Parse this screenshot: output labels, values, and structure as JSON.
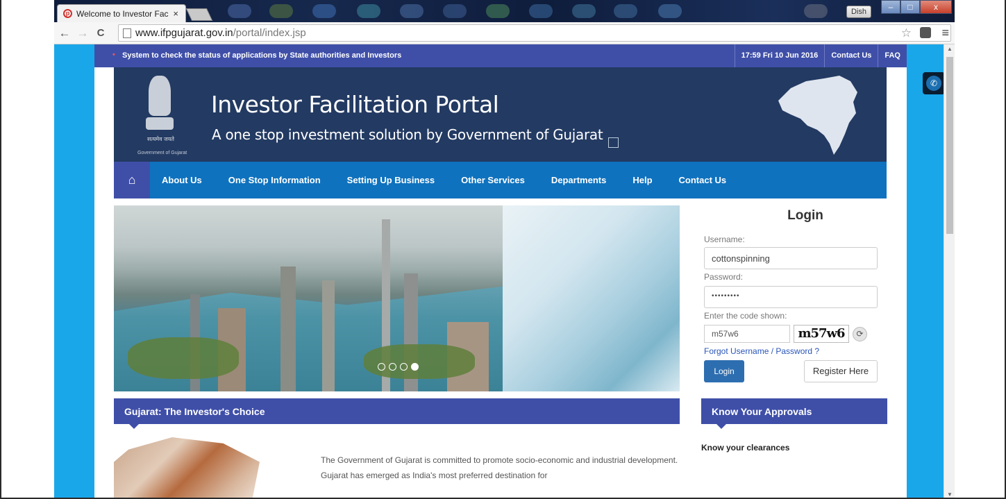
{
  "browser": {
    "tab_title": "Welcome to Investor Facil",
    "tab_close": "×",
    "url_domain": "www.ifpgujarat.gov.in",
    "url_path": "/portal/index.jsp",
    "profile_label": "Dish",
    "minimize": "–",
    "maximize": "□",
    "close": "x"
  },
  "topbar": {
    "ticker": "System to check the status of applications by State authorities and Investors",
    "time": "17:59  Fri  10 Jun 2016",
    "contact": "Contact Us",
    "faq": "FAQ"
  },
  "banner": {
    "title": "Investor Facilitation Portal",
    "subtitle": "A one stop investment solution by Government of Gujarat",
    "emblem_motto": "सत्यमेव जयते",
    "emblem_caption": "Government of Gujarat"
  },
  "nav": {
    "items": [
      "About Us",
      "One Stop Information",
      "Setting Up Business",
      "Other Services",
      "Departments",
      "Help",
      "Contact Us"
    ]
  },
  "login": {
    "title": "Login",
    "username_label": "Username:",
    "username_value": "cottonspinning",
    "password_label": "Password:",
    "password_value": "•••••••••",
    "code_label": "Enter the code shown:",
    "code_value": "m57w6",
    "captcha_text": "m57w6",
    "forgot": "Forgot Username / Password ?",
    "login_button": "Login",
    "register_button": "Register Here"
  },
  "sections": {
    "investor_choice": "Gujarat: The Investor's Choice",
    "approvals": "Know Your Approvals",
    "clearances": "Know your clearances",
    "intro_text": "The Government of Gujarat is committed to promote socio-economic and industrial development. Gujarat has emerged as India's most preferred destination for"
  },
  "slider": {
    "current_slide": 4,
    "total_slides": 4
  }
}
